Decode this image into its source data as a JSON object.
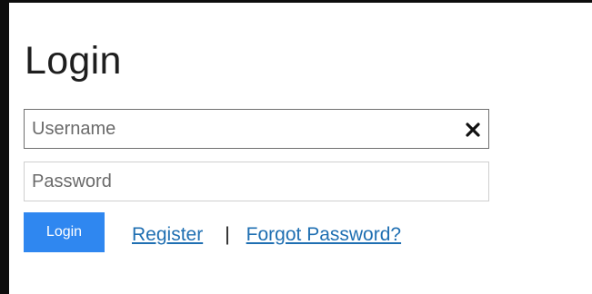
{
  "form": {
    "title": "Login",
    "username": {
      "placeholder": "Username",
      "value": ""
    },
    "password": {
      "placeholder": "Password",
      "value": ""
    },
    "clear_icon": "close-icon"
  },
  "actions": {
    "login_label": "Login",
    "register_label": "Register",
    "separator": "|",
    "forgot_label": "Forgot Password?"
  },
  "colors": {
    "button_bg": "#2f87f0",
    "link": "#1f6fb2"
  }
}
